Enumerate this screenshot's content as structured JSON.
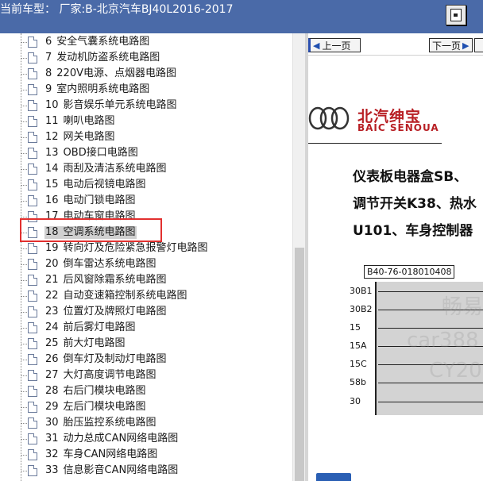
{
  "header": {
    "title": "当前车型： 厂家:B-北京汽车BJ40L2016-2017"
  },
  "tree": {
    "items": [
      {
        "num": "6",
        "label": "安全气囊系统电路图"
      },
      {
        "num": "7",
        "label": "发动机防盗系统电路图"
      },
      {
        "num": "8",
        "label": "220V电源、点烟器电路图"
      },
      {
        "num": "9",
        "label": "室内照明系统电路图"
      },
      {
        "num": "10",
        "label": "影音娱乐单元系统电路图"
      },
      {
        "num": "11",
        "label": "喇叭电路图"
      },
      {
        "num": "12",
        "label": "网关电路图"
      },
      {
        "num": "13",
        "label": "OBD接口电路图"
      },
      {
        "num": "14",
        "label": "雨刮及清洁系统电路图"
      },
      {
        "num": "15",
        "label": "电动后视镜电路图"
      },
      {
        "num": "16",
        "label": "电动门锁电路图"
      },
      {
        "num": "17",
        "label": "电动车窗电路图"
      },
      {
        "num": "18",
        "label": "空调系统电路图",
        "selected": true
      },
      {
        "num": "19",
        "label": "转向灯及危险紧急报警灯电路图"
      },
      {
        "num": "20",
        "label": "倒车雷达系统电路图"
      },
      {
        "num": "21",
        "label": "后风窗除霜系统电路图"
      },
      {
        "num": "22",
        "label": "自动变速箱控制系统电路图"
      },
      {
        "num": "23",
        "label": "位置灯及牌照灯电路图"
      },
      {
        "num": "24",
        "label": "前后雾灯电路图"
      },
      {
        "num": "25",
        "label": "前大灯电路图"
      },
      {
        "num": "26",
        "label": "倒车灯及制动灯电路图"
      },
      {
        "num": "27",
        "label": "大灯高度调节电路图"
      },
      {
        "num": "28",
        "label": "右后门模块电路图"
      },
      {
        "num": "29",
        "label": "左后门模块电路图"
      },
      {
        "num": "30",
        "label": "胎压监控系统电路图"
      },
      {
        "num": "31",
        "label": "动力总成CAN网络电路图"
      },
      {
        "num": "32",
        "label": "车身CAN网络电路图"
      },
      {
        "num": "33",
        "label": "信息影音CAN网络电路图"
      }
    ]
  },
  "viewer": {
    "prev_label": "上一页",
    "next_label": "下一页",
    "brand_cn": "北汽绅宝",
    "brand_en": "BAIC SENOUA",
    "text_lines": [
      "仪表板电器盒SB、",
      "调节开关K38、热水",
      "U101、车身控制器"
    ],
    "part_number": "B40-76-018010408",
    "pins": [
      "30B1",
      "30B2",
      "15",
      "15A",
      "15C",
      "58b",
      "30"
    ],
    "watermarks": [
      "畅易",
      "car388",
      "CY20"
    ]
  },
  "colors": {
    "header_bg": "#4a6aa8",
    "highlight": "#e2302f",
    "brand": "#b81f24"
  }
}
